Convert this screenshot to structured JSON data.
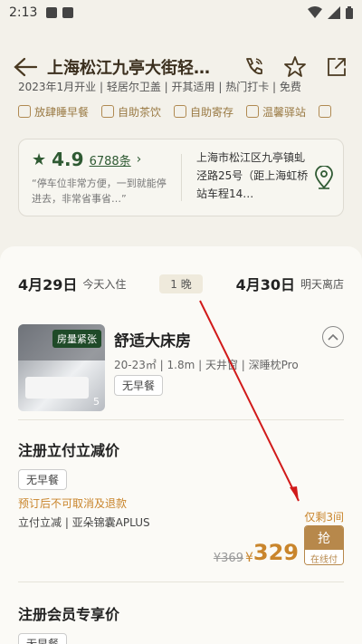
{
  "status": {
    "time": "2:13"
  },
  "header": {
    "title": "上海松江九亭大街轻…"
  },
  "peek_text": "2023年1月开业 | 轻居尔卫盖 | 开其适用 | 热门打卡 | 免费",
  "amenities": [
    {
      "label": "放肆睡早餐",
      "icon": "breakfast-icon"
    },
    {
      "label": "自助茶饮",
      "icon": "tea-icon"
    },
    {
      "label": "自助寄存",
      "icon": "locker-icon"
    },
    {
      "label": "温馨驿站",
      "icon": "lounge-icon"
    },
    {
      "label": "",
      "icon": "more-icon"
    }
  ],
  "rating": {
    "score": "4.9",
    "reviews": "6788条",
    "quote": "“停车位非常方便，一到就能停进去，非常省事省…”"
  },
  "address": "上海市松江区九亭镇虬泾路25号（距上海虹桥站车程14…",
  "dates": {
    "checkin_date": "4月29日",
    "checkin_label": "今天入住",
    "nights": "1 晚",
    "checkout_date": "4月30日",
    "checkout_label": "明天离店"
  },
  "room": {
    "tag": "房量紧张",
    "photo_count": "5",
    "name": "舒适大床房",
    "spec": "20-23㎡ | 1.8m | 天井窗 | 深睡枕Pro",
    "meal": "无早餐"
  },
  "rate1": {
    "title": "注册立付立减价",
    "meal": "无早餐",
    "policy": "预订后不可取消及退款",
    "pay": "立付立减 | 亚朵锦囊APLUS",
    "remaining": "仅剩3间",
    "original_price": "¥369",
    "currency": "¥",
    "price": "329",
    "book_label": "抢",
    "book_sub": "在线付"
  },
  "rate2": {
    "title": "注册会员专享价",
    "meal": "无早餐"
  },
  "colors": {
    "brand": "#2f5a33",
    "accent": "#c9852c",
    "button": "#b7884b",
    "annotation_arrow": "#d11a1a"
  }
}
